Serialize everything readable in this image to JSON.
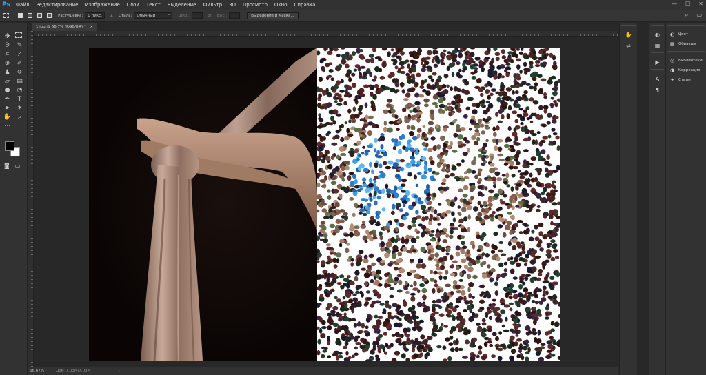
{
  "app": {
    "logo": "Ps"
  },
  "menu": [
    "Файл",
    "Редактирование",
    "Изображение",
    "Слои",
    "Текст",
    "Выделение",
    "Фильтр",
    "3D",
    "Просмотр",
    "Окно",
    "Справка"
  ],
  "window_controls": {
    "minimize": "—",
    "maximize": "☐",
    "close": "✕"
  },
  "options": {
    "feather_label": "Растушевка:",
    "feather_value": "0 пикс.",
    "style_label": "Стиль:",
    "style_value": "Обычный",
    "width_label": "Шир.:",
    "height_label": "Выс.:",
    "mask_button": "Выделение и маска..."
  },
  "document": {
    "tab_title": "1.jpg @ 66,7% (RGB/8#) *",
    "close": "×"
  },
  "status": {
    "zoom": "66,67%",
    "doc_size": "Док: 7,03M/7,03M",
    "arrow": "›"
  },
  "right_panel": {
    "group1": [
      {
        "icon": "color-icon",
        "glyph": "◐",
        "label": "Цвет"
      },
      {
        "icon": "swatches-icon",
        "glyph": "▦",
        "label": "Образцы"
      }
    ],
    "group2": [
      {
        "icon": "libraries-icon",
        "glyph": "◎",
        "label": "Библиотеки"
      },
      {
        "icon": "adjustments-icon",
        "glyph": "◑",
        "label": "Коррекция"
      },
      {
        "icon": "styles-icon",
        "glyph": "✦",
        "label": "Стили"
      }
    ]
  },
  "colors": {
    "foreground": "#000000",
    "background": "#ffffff",
    "accent": "#31a8ff"
  }
}
